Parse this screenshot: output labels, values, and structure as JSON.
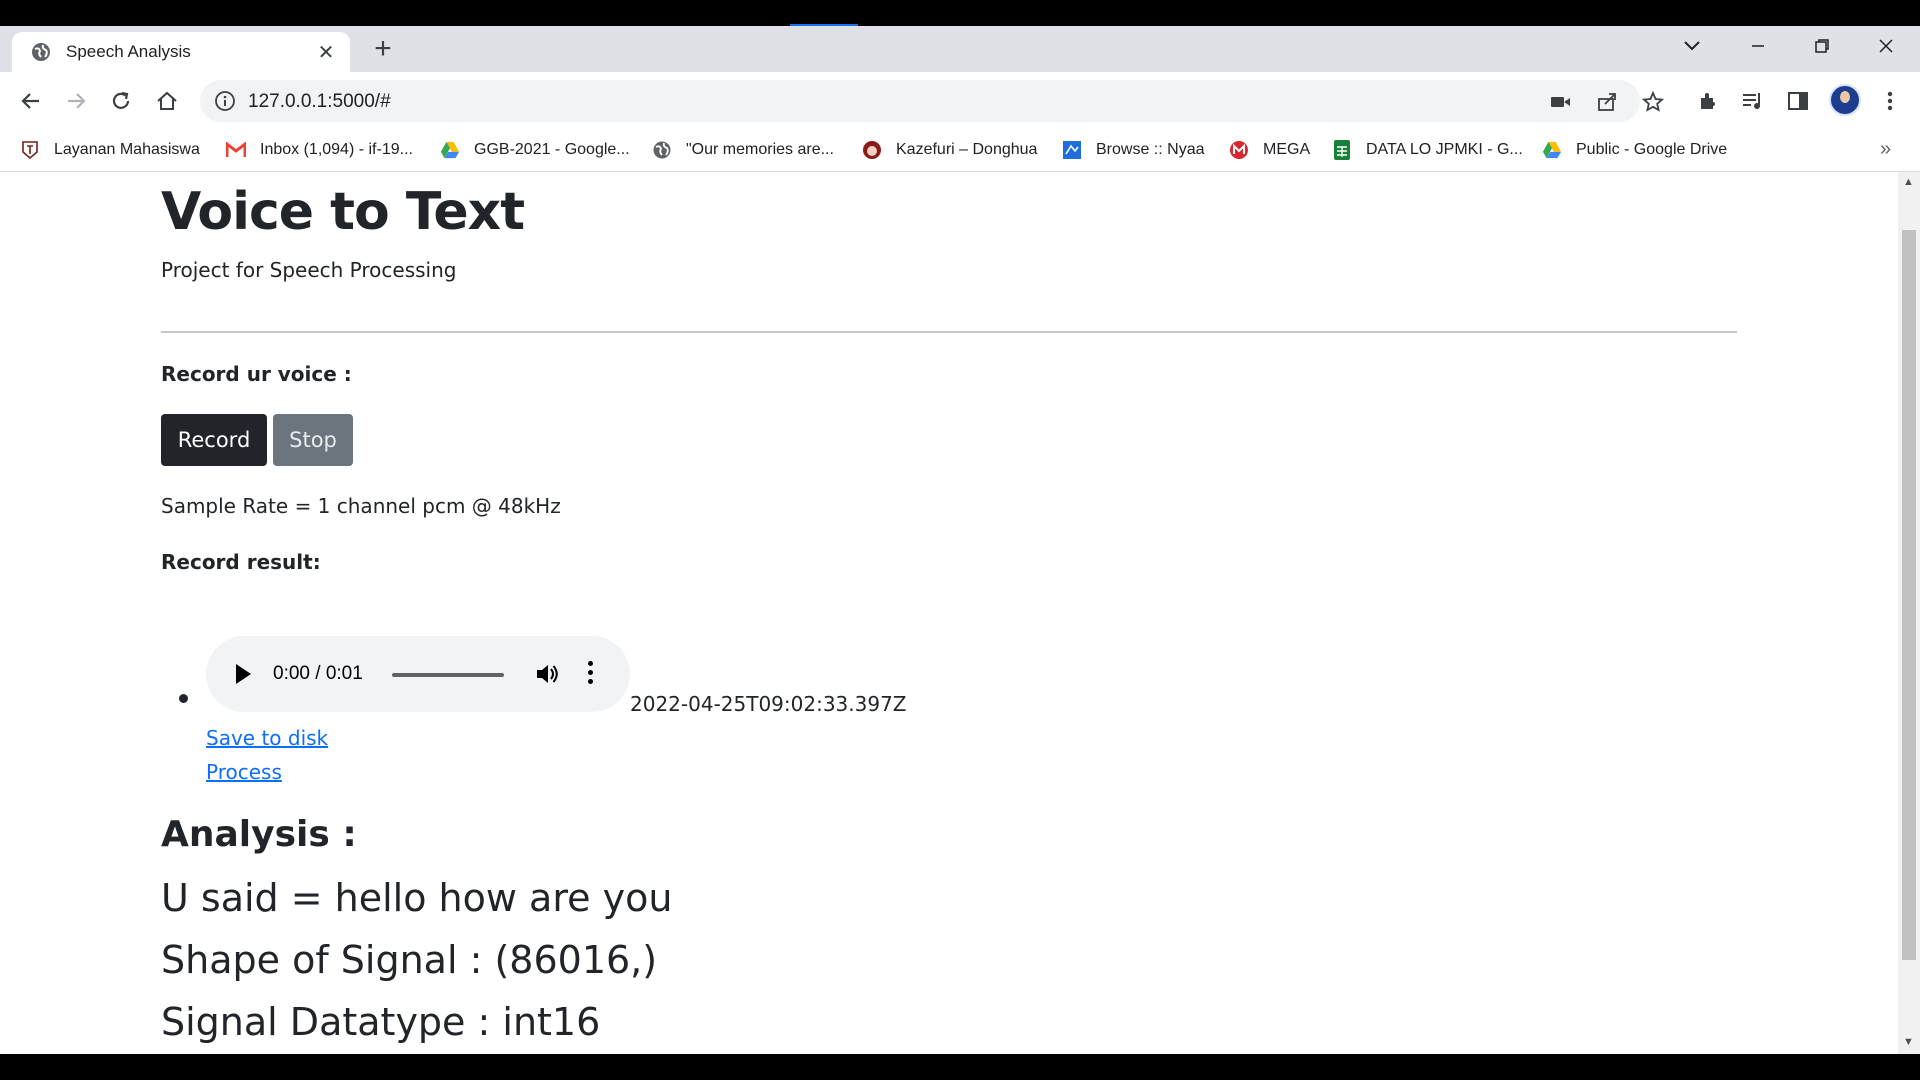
{
  "browser": {
    "tab": {
      "title": "Speech Analysis"
    },
    "url": "127.0.0.1:5000/#",
    "bookmarks": [
      {
        "label": "Layanan Mahasiswa",
        "icon": "university-icon"
      },
      {
        "label": "Inbox (1,094) - if-19...",
        "icon": "gmail-icon"
      },
      {
        "label": "GGB-2021 - Google...",
        "icon": "google-drive-icon"
      },
      {
        "label": "\"Our memories are...",
        "icon": "globe-icon"
      },
      {
        "label": "Kazefuri – Donghua",
        "icon": "kazefuri-icon"
      },
      {
        "label": "Browse :: Nyaa",
        "icon": "nyaa-icon"
      },
      {
        "label": "MEGA",
        "icon": "mega-icon"
      },
      {
        "label": "DATA LO JPMKI - G...",
        "icon": "google-sheets-icon"
      },
      {
        "label": "Public - Google Drive",
        "icon": "google-drive-icon"
      }
    ]
  },
  "page": {
    "title": "Voice to Text",
    "subtitle": "Project for Speech Processing",
    "record_label": "Record ur voice :",
    "record_button": "Record",
    "stop_button": "Stop",
    "sample_rate": "Sample Rate = 1 channel pcm @ 48kHz",
    "result_label": "Record result:",
    "recording": {
      "time": "0:00 / 0:01",
      "timestamp": "2022-04-25T09:02:33.397Z",
      "save_link": "Save to disk",
      "process_link": "Process"
    },
    "analysis_title": "Analysis :",
    "results": [
      "U said = hello how are you",
      "Shape of Signal : (86016,)",
      "Signal Datatype : int16"
    ]
  },
  "colors": {
    "primary_dark": "#212529",
    "secondary": "#6c757d",
    "link": "#0d6efd"
  }
}
